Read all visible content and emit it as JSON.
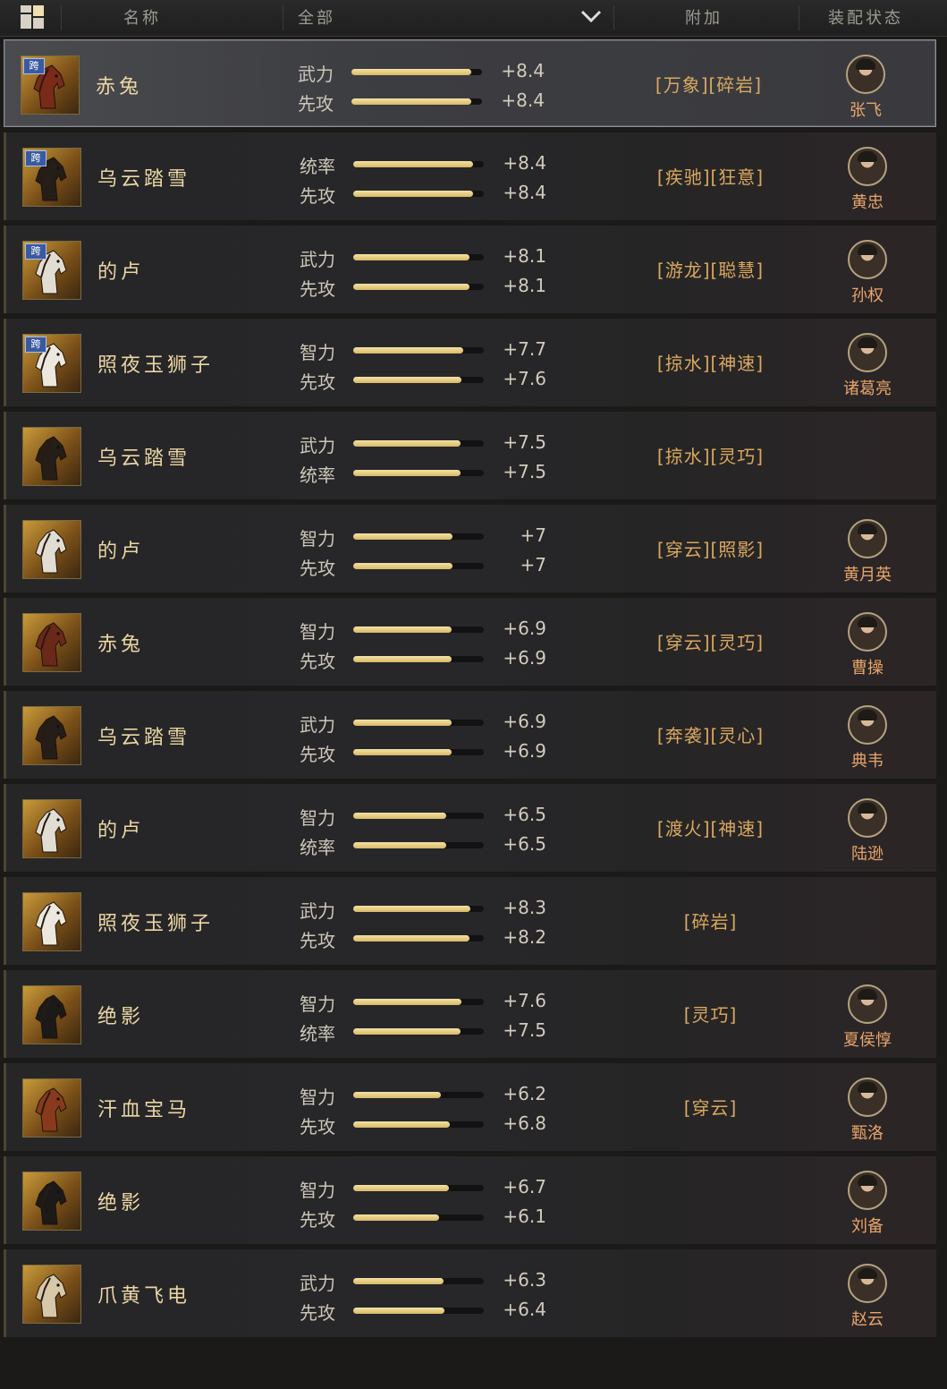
{
  "header": {
    "col_name": "名称",
    "filter_value": "全部",
    "col_extra": "附加",
    "col_equip": "装配状态"
  },
  "rows": [
    {
      "name": "赤兔",
      "cross": "跨",
      "selected": true,
      "stat1": {
        "label": "武力",
        "value": "+8.4",
        "pct": 0.92
      },
      "stat2": {
        "label": "先攻",
        "value": "+8.4",
        "pct": 0.92
      },
      "extra": "[万象][碎岩]",
      "general": "张飞",
      "coat": "#7a2a18"
    },
    {
      "name": "乌云踏雪",
      "cross": "跨",
      "stat1": {
        "label": "统率",
        "value": "+8.4",
        "pct": 0.92
      },
      "stat2": {
        "label": "先攻",
        "value": "+8.4",
        "pct": 0.92
      },
      "extra": "[疾驰][狂意]",
      "general": "黄忠",
      "coat": "#241d18"
    },
    {
      "name": "的卢",
      "cross": "跨",
      "stat1": {
        "label": "武力",
        "value": "+8.1",
        "pct": 0.89
      },
      "stat2": {
        "label": "先攻",
        "value": "+8.1",
        "pct": 0.89
      },
      "extra": "[游龙][聪慧]",
      "general": "孙权",
      "coat": "#e2ddd2"
    },
    {
      "name": "照夜玉狮子",
      "cross": "跨",
      "stat1": {
        "label": "智力",
        "value": "+7.7",
        "pct": 0.84
      },
      "stat2": {
        "label": "先攻",
        "value": "+7.6",
        "pct": 0.83
      },
      "extra": "[掠水][神速]",
      "general": "诸葛亮",
      "coat": "#ece8de"
    },
    {
      "name": "乌云踏雪",
      "stat1": {
        "label": "武力",
        "value": "+7.5",
        "pct": 0.82
      },
      "stat2": {
        "label": "统率",
        "value": "+7.5",
        "pct": 0.82
      },
      "extra": "[掠水][灵巧]",
      "general": "",
      "coat": "#241d18"
    },
    {
      "name": "的卢",
      "stat1": {
        "label": "智力",
        "value": "+7",
        "pct": 0.76
      },
      "stat2": {
        "label": "先攻",
        "value": "+7",
        "pct": 0.76
      },
      "extra": "[穿云][照影]",
      "general": "黄月英",
      "coat": "#e2ddd2"
    },
    {
      "name": "赤兔",
      "stat1": {
        "label": "智力",
        "value": "+6.9",
        "pct": 0.75
      },
      "stat2": {
        "label": "先攻",
        "value": "+6.9",
        "pct": 0.75
      },
      "extra": "[穿云][灵巧]",
      "general": "曹操",
      "coat": "#6a2818"
    },
    {
      "name": "乌云踏雪",
      "stat1": {
        "label": "武力",
        "value": "+6.9",
        "pct": 0.75
      },
      "stat2": {
        "label": "先攻",
        "value": "+6.9",
        "pct": 0.75
      },
      "extra": "[奔袭][灵心]",
      "general": "典韦",
      "coat": "#241d18"
    },
    {
      "name": "的卢",
      "stat1": {
        "label": "智力",
        "value": "+6.5",
        "pct": 0.71
      },
      "stat2": {
        "label": "统率",
        "value": "+6.5",
        "pct": 0.71
      },
      "extra": "[渡火][神速]",
      "general": "陆逊",
      "coat": "#e2ddd2"
    },
    {
      "name": "照夜玉狮子",
      "stat1": {
        "label": "武力",
        "value": "+8.3",
        "pct": 0.9
      },
      "stat2": {
        "label": "先攻",
        "value": "+8.2",
        "pct": 0.89
      },
      "extra": "[碎岩]",
      "general": "",
      "coat": "#ece8de"
    },
    {
      "name": "绝影",
      "stat1": {
        "label": "智力",
        "value": "+7.6",
        "pct": 0.83
      },
      "stat2": {
        "label": "统率",
        "value": "+7.5",
        "pct": 0.82
      },
      "extra": "[灵巧]",
      "general": "夏侯惇",
      "coat": "#1c1a19"
    },
    {
      "name": "汗血宝马",
      "stat1": {
        "label": "智力",
        "value": "+6.2",
        "pct": 0.67
      },
      "stat2": {
        "label": "先攻",
        "value": "+6.8",
        "pct": 0.74
      },
      "extra": "[穿云]",
      "general": "甄洛",
      "coat": "#8a3a1c"
    },
    {
      "name": "绝影",
      "stat1": {
        "label": "智力",
        "value": "+6.7",
        "pct": 0.73
      },
      "stat2": {
        "label": "先攻",
        "value": "+6.1",
        "pct": 0.66
      },
      "extra": "",
      "general": "刘备",
      "coat": "#1c1a19"
    },
    {
      "name": "爪黄飞电",
      "stat1": {
        "label": "武力",
        "value": "+6.3",
        "pct": 0.69
      },
      "stat2": {
        "label": "先攻",
        "value": "+6.4",
        "pct": 0.7
      },
      "extra": "",
      "general": "赵云",
      "coat": "#d6c8a8"
    }
  ]
}
